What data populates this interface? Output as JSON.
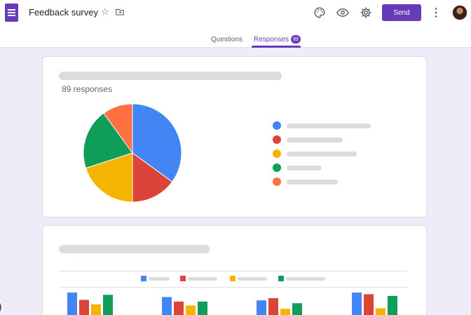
{
  "app": {
    "title": "Feedback survey",
    "accent": "#673ab7",
    "send_label": "Send"
  },
  "tabs": {
    "questions_label": "Questions",
    "responses_label": "Responses",
    "responses_badge": "89"
  },
  "icons": {
    "star": "☆",
    "folder": "folder-move",
    "palette": "palette",
    "preview": "eye",
    "settings": "gear",
    "more": "⋮"
  },
  "summary": {
    "responses_text": "89 responses"
  },
  "chart_data": [
    {
      "type": "pie",
      "title": "",
      "slices": [
        {
          "color": "#4285f4",
          "value": 35
        },
        {
          "color": "#db4437",
          "value": 15
        },
        {
          "color": "#f4b400",
          "value": 20
        },
        {
          "color": "#0f9d58",
          "value": 20
        },
        {
          "color": "#ff7043",
          "value": 10
        }
      ]
    },
    {
      "type": "bar",
      "title": "",
      "categories": [
        "",
        "",
        "",
        ""
      ],
      "series": [
        {
          "color": "#4285f4",
          "values": [
            4,
            3.2,
            2.6,
            4
          ]
        },
        {
          "color": "#db4437",
          "values": [
            2.7,
            2.4,
            3,
            3.7
          ]
        },
        {
          "color": "#f4b400",
          "values": [
            1.9,
            1.7,
            1.1,
            1.2
          ]
        },
        {
          "color": "#0f9d58",
          "values": [
            3.6,
            2.4,
            2.1,
            3.4
          ]
        }
      ]
    }
  ]
}
